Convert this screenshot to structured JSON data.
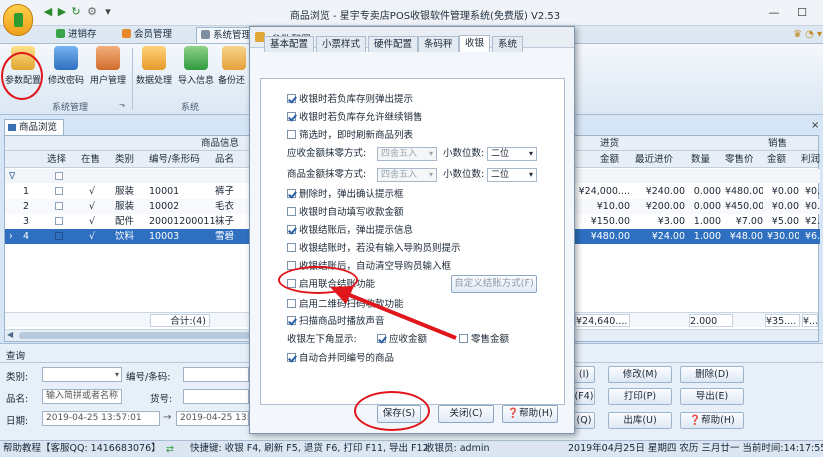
{
  "window": {
    "title": "商品浏览 - 星宇专卖店POS收银软件管理系统(免费版) V2.53"
  },
  "ribbon": {
    "tabs": [
      {
        "label": "进销存"
      },
      {
        "label": "会员管理"
      },
      {
        "label": "系统管理"
      }
    ],
    "buttons": [
      {
        "label": "参数配置"
      },
      {
        "label": "修改密码"
      },
      {
        "label": "用户管理"
      },
      {
        "label": "数据处理"
      },
      {
        "label": "导入信息"
      },
      {
        "label": "备份还"
      }
    ],
    "groups": [
      {
        "label": "系统管理"
      },
      {
        "label": "系统"
      }
    ]
  },
  "doc_tab": "商品浏览",
  "grid": {
    "group_headers": {
      "info": "商品信息",
      "purchase": "进货",
      "sales": "销售"
    },
    "columns": [
      "选择",
      "在售",
      "类别",
      "编号/条形码",
      "品名"
    ],
    "right_columns": [
      "金额",
      "最近进价",
      "数量",
      "零售价",
      "金额",
      "利润"
    ],
    "rows": [
      {
        "n": "1",
        "check": false,
        "onsale": "√",
        "cat": "服装",
        "code": "10001",
        "name": "裤子",
        "amt": "¥24,000....",
        "last": "¥240.00",
        "qty": "0.000",
        "retail": "¥480.00",
        "samt": "¥0.00",
        "profit": "¥0."
      },
      {
        "n": "2",
        "check": false,
        "onsale": "√",
        "cat": "服装",
        "code": "10002",
        "name": "毛衣",
        "amt": "¥10.00",
        "last": "¥200.00",
        "qty": "0.000",
        "retail": "¥450.00",
        "samt": "¥0.00",
        "profit": "¥0."
      },
      {
        "n": "3",
        "check": false,
        "onsale": "√",
        "cat": "配件",
        "code": "20001200011",
        "name": "袜子",
        "amt": "¥150.00",
        "last": "¥3.00",
        "qty": "1.000",
        "retail": "¥7.00",
        "samt": "¥5.00",
        "profit": "¥2."
      },
      {
        "n": "4",
        "check": true,
        "onsale": "√",
        "cat": "饮料",
        "code": "10003",
        "name": "雪碧",
        "amt": "¥480.00",
        "last": "¥24.00",
        "qty": "1.000",
        "retail": "¥48.00",
        "samt": "¥30.00",
        "profit": "¥6."
      }
    ],
    "total_label": "合计:(4)",
    "totals": {
      "amt": "¥24,640....",
      "qty": "2.000",
      "samt": "¥35....",
      "profit": "¥..."
    }
  },
  "query": {
    "title": "查询",
    "category_label": "类别:",
    "code_label": "编号/条码:",
    "name_label": "品名:",
    "name_placeholder": "输入简拼或者名称",
    "goods_no_label": "货号:",
    "date_label": "日期:",
    "date_from": "2019-04-25 13:57:01",
    "date_to": "2019-04-25 13:57",
    "buttons": [
      "(I)",
      "修改(M)",
      "删除(D)",
      "(F4)",
      "打印(P)",
      "导出(E)",
      "(Q)",
      "出库(U)",
      "帮助(H)"
    ]
  },
  "status": {
    "left": "帮助教程【客服QQ: 1416683076】",
    "shortcuts": "快捷键: 收银 F4, 刷新 F5, 退货 F6, 打印 F11, 导出 F12",
    "user": "收银员: admin",
    "datetime": "2019年04月25日 星期四 农历 三月廿一 当前时间:14:17:55"
  },
  "dialog": {
    "title": "参数配置",
    "tabs": [
      "基本配置",
      "小票样式",
      "硬件配置",
      "条码秤",
      "收银",
      "系统"
    ],
    "options": [
      {
        "label": "收银时若负库存则弹出提示",
        "checked": true
      },
      {
        "label": "收银时若负库存允许继续销售",
        "checked": true
      },
      {
        "label": "筛选时，即时刷新商品列表",
        "checked": false
      }
    ],
    "rounding": {
      "receivable_label": "应收金额抹零方式:",
      "receivable_mode": "四舍五入",
      "receivable_dec_label": "小数位数:",
      "receivable_dec": "二位",
      "goods_label": "商品金额抹零方式:",
      "goods_mode": "四舍五入",
      "goods_dec_label": "小数位数:",
      "goods_dec": "二位"
    },
    "options2": [
      {
        "label": "删除时，弹出确认提示框",
        "checked": true
      },
      {
        "label": "收银时自动填写收款金额",
        "checked": false
      },
      {
        "label": "收银结账后，弹出提示信息",
        "checked": true
      },
      {
        "label": "收银结账时，若没有输入导购员则提示",
        "checked": false
      },
      {
        "label": "收银结账后，自动清空导购员输入框",
        "checked": false
      },
      {
        "label": "启用联合结账功能",
        "checked": false
      },
      {
        "label": "启用二维码扫码收款功能",
        "checked": false
      },
      {
        "label": "扫描商品时播放声音",
        "checked": true
      }
    ],
    "custom_settle_button": "自定义结账方式(F)",
    "display_label": "收银左下角显示:",
    "display_options": [
      {
        "label": "应收金额",
        "checked": true
      },
      {
        "label": "零售金额",
        "checked": false
      }
    ],
    "merge_option": {
      "label": "自动合并同编号的商品",
      "checked": true
    },
    "save": "保存(S)",
    "close": "关闭(C)",
    "help": "帮助(H)"
  }
}
